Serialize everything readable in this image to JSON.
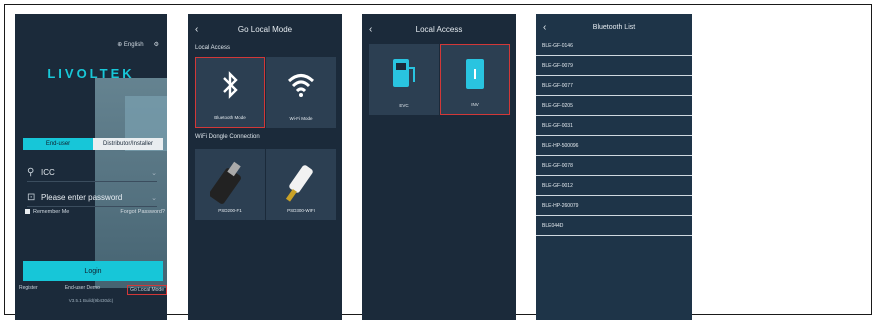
{
  "login": {
    "language": "English",
    "settings_icon": "gear-icon",
    "globe_icon": "globe-icon",
    "logo_text": "LIVOLTEK",
    "tabs": [
      {
        "label": "End-user",
        "active": true
      },
      {
        "label": "Distributor/Installer",
        "active": false
      }
    ],
    "username": {
      "value": "ICC",
      "icon": "user-icon"
    },
    "password": {
      "placeholder": "Please enter password",
      "icon": "lock-icon"
    },
    "remember_label": "Remember Me",
    "forgot_label": "Forgot Password?",
    "login_button": "Login",
    "links": {
      "register": "Register",
      "demo": "End-user Demo",
      "local_mode": "Go Local Mode"
    },
    "version": "V3.5.1 Build(9b430dc)",
    "colors": {
      "accent": "#17c6d8",
      "background": "#1b2a3a",
      "highlight": "#d23838"
    }
  },
  "go_local": {
    "title": "Go Local Mode",
    "section_local": "Local Access",
    "section_dongle": "WiFi Dongle Connection",
    "cards": [
      {
        "label": "Bluetooth Mode",
        "icon": "bluetooth-icon",
        "selected": true
      },
      {
        "label": "Wi-Fi Mode",
        "icon": "wifi-icon",
        "selected": false
      },
      {
        "label": "PSD200-F1",
        "icon": "dongle-icon",
        "selected": false
      },
      {
        "label": "PSD300-WIFI",
        "icon": "dongle-icon",
        "selected": false
      }
    ]
  },
  "local_access": {
    "title": "Local Access",
    "cards": [
      {
        "label": "EVC",
        "icon": "ev-charger-icon",
        "selected": false
      },
      {
        "label": "INV",
        "icon": "inverter-icon",
        "selected": true
      }
    ]
  },
  "bluetooth": {
    "title": "Bluetooth List",
    "devices": [
      "BLE-GF-0146",
      "BLE-GF-0079",
      "BLE-GF-0077",
      "BLE-GF-0205",
      "BLE-GF-0031",
      "BLE-HP-500096",
      "BLE-GF-0078",
      "BLE-GF-0012",
      "BLE-HP-260079",
      "BLE044D"
    ]
  }
}
